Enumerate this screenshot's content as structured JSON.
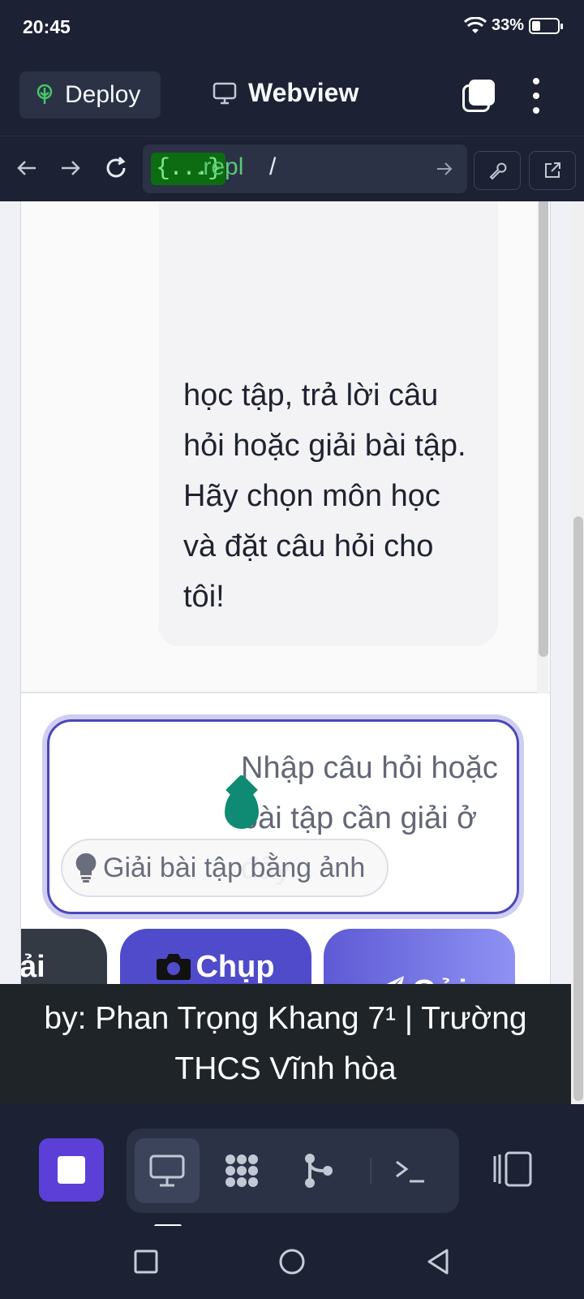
{
  "status_bar": {
    "time": "20:45",
    "battery": "33%"
  },
  "header": {
    "deploy_label": "Deploy",
    "webview_label": "Webview"
  },
  "url_bar": {
    "badge": "{...}",
    "host": ".repl",
    "path": "/"
  },
  "chat": {
    "bot_message": "học tập, trả lời câu hỏi hoặc giải bài tập. Hãy chọn môn học và đặt câu hỏi cho tôi!"
  },
  "input": {
    "placeholder": "Nhập câu hỏi hoặc bài tập cần giải ở đây...",
    "hint": "Giải bài tập bằng ảnh"
  },
  "buttons": {
    "upload_label": "Tải ảnh",
    "upload_visible_line1": "ải",
    "upload_visible_line2": "h",
    "camera_label": "Chụp ảnh",
    "send_label": "Gửi"
  },
  "footer": {
    "credit": "by: Phan Trọng Khang 7¹ | Trường THCS Vĩnh hòa"
  },
  "colors": {
    "accent": "#4f4bcb",
    "send_gradient_start": "#5e5ad5",
    "send_gradient_end": "#8f92f3",
    "footer_bg": "#1f2429",
    "replit_bg": "#1c2133",
    "stop_button": "#5b3fd6"
  },
  "icons": {
    "deploy": "deploy-tree-icon",
    "webview": "monitor-icon",
    "camera": "camera-icon",
    "send": "paper-plane-icon",
    "hint": "lightbulb-icon"
  }
}
